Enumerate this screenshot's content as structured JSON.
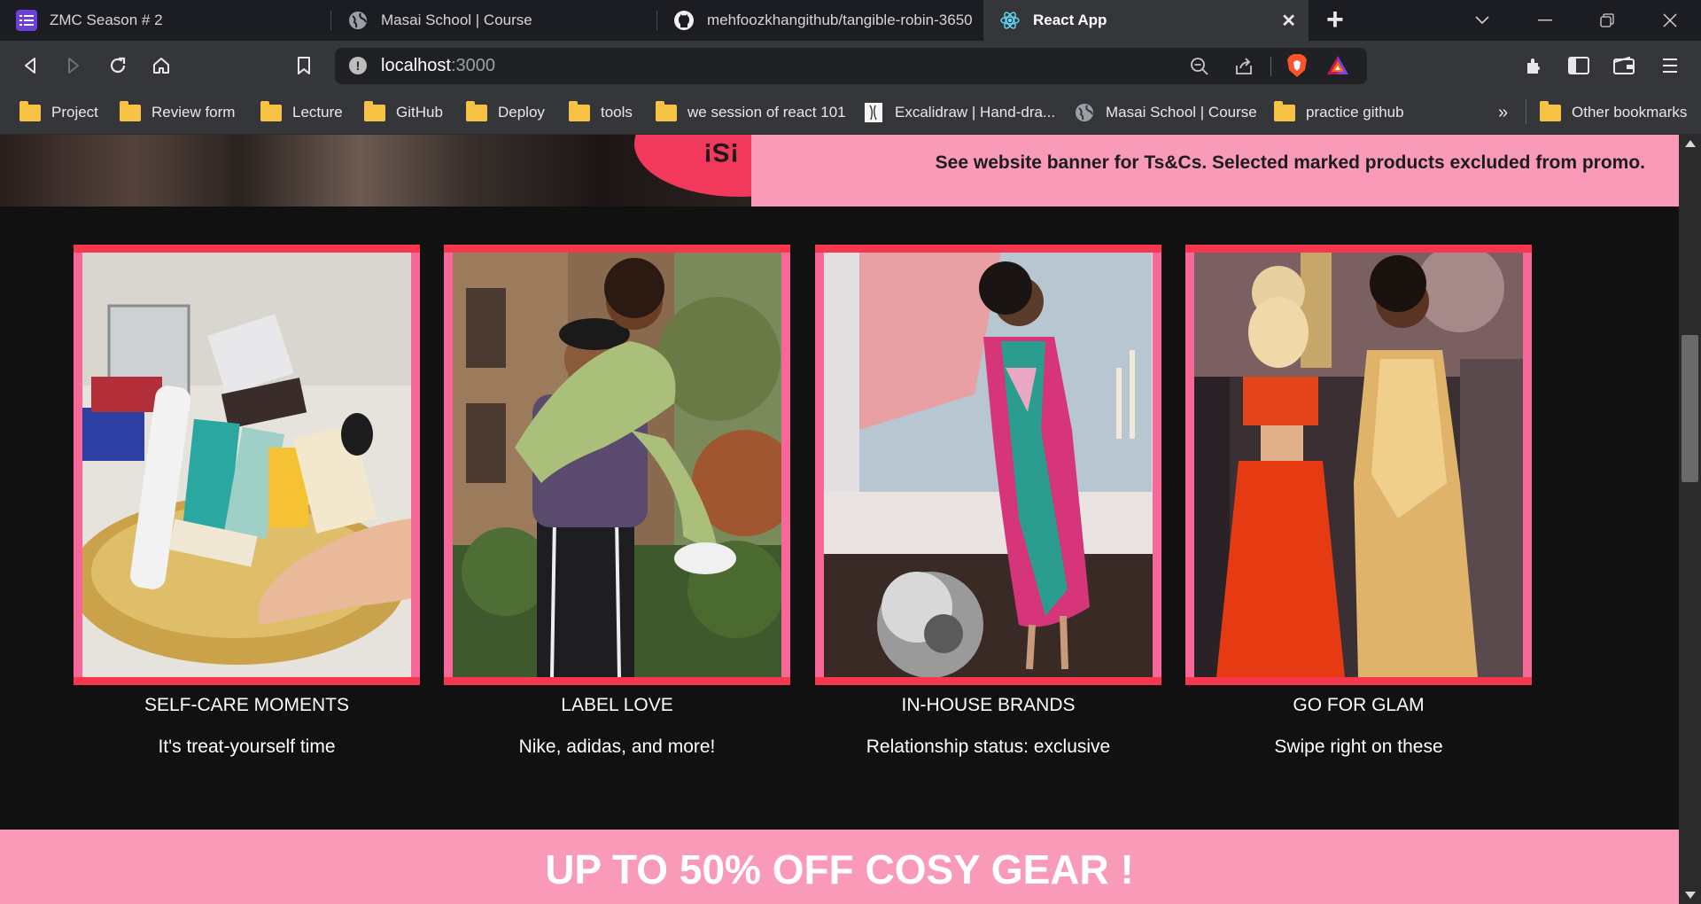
{
  "browser": {
    "tabs": [
      {
        "title": "ZMC Season # 2",
        "icon": "list-icon",
        "active": false
      },
      {
        "title": "Masai School | Course",
        "icon": "globe-icon",
        "active": false
      },
      {
        "title": "mehfoozkhangithub/tangible-robin-3650",
        "icon": "github-icon",
        "active": false
      },
      {
        "title": "React App",
        "icon": "react-icon",
        "active": true
      }
    ],
    "close_tab_glyph": "✕",
    "new_tab_glyph": "+",
    "address": {
      "host": "localhost",
      "port": ":3000"
    },
    "bookmarks": [
      {
        "label": "Project",
        "icon": "folder-icon"
      },
      {
        "label": "Review form",
        "icon": "folder-icon"
      },
      {
        "label": "Lecture",
        "icon": "folder-icon"
      },
      {
        "label": "GitHub",
        "icon": "folder-icon"
      },
      {
        "label": "Deploy",
        "icon": "folder-icon"
      },
      {
        "label": "tools",
        "icon": "folder-icon"
      },
      {
        "label": "we session of react 101",
        "icon": "folder-icon"
      },
      {
        "label": "Excalidraw | Hand-dra...",
        "icon": "excalidraw-icon"
      },
      {
        "label": "Masai School | Course",
        "icon": "globe-icon"
      },
      {
        "label": "practice github",
        "icon": "folder-icon"
      }
    ],
    "bookmarks_overflow": "»",
    "other_bookmarks": "Other bookmarks"
  },
  "page": {
    "hero_badge": "!S!",
    "hero_note": "See website banner for Ts&Cs. Selected marked products excluded from promo.",
    "cards": [
      {
        "title": "SELF-CARE MOMENTS",
        "subtitle": "It's treat-yourself time"
      },
      {
        "title": "LABEL LOVE",
        "subtitle": "Nike, adidas, and more!"
      },
      {
        "title": "IN-HOUSE BRANDS",
        "subtitle": "Relationship status: exclusive"
      },
      {
        "title": "GO FOR GLAM",
        "subtitle": "Swipe right on these"
      }
    ],
    "promo": "UP TO 50% OFF COSY GEAR !"
  },
  "colors": {
    "banner_pink": "#f89ab8",
    "frame_pink": "#f7679a",
    "frame_red": "#f7374e",
    "page_bg": "#111111"
  }
}
